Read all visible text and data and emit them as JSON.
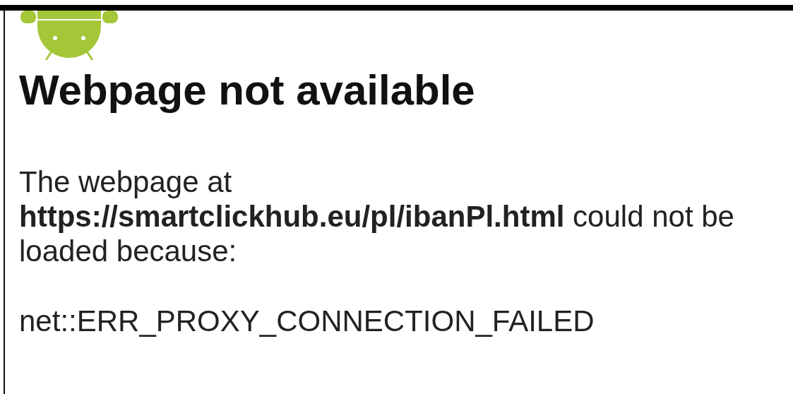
{
  "heading": "Webpage not available",
  "message": "The webpage at **https://smartclickhub.eu/pl/ibanPl.html** could not be loaded because:",
  "error_code": "net::ERR_PROXY_CONNECTION_FAILED"
}
